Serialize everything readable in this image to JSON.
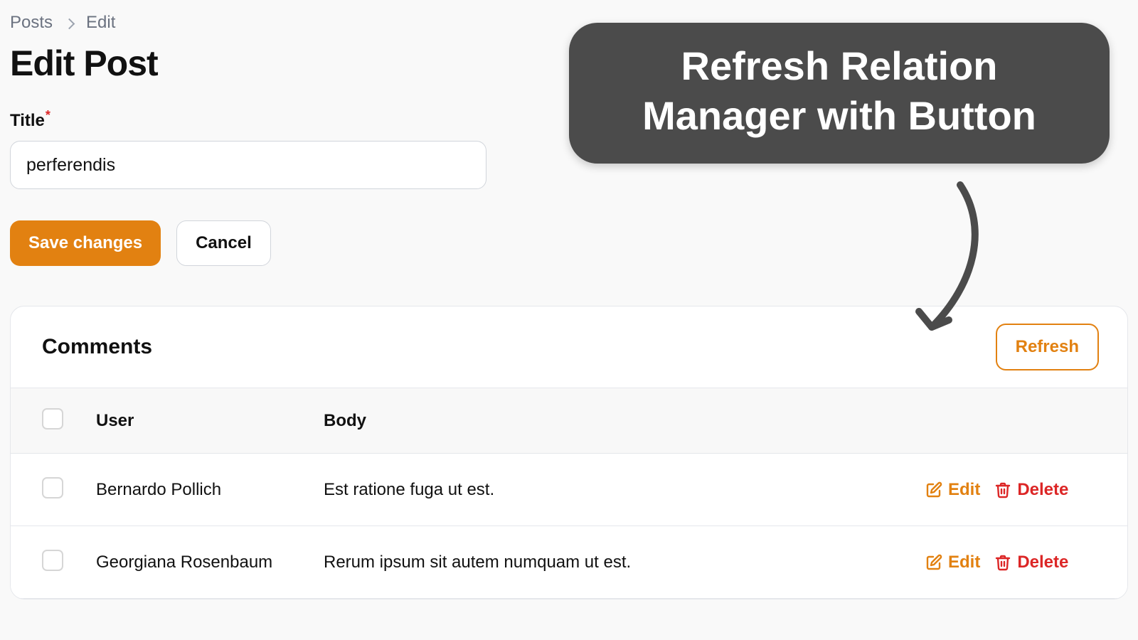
{
  "breadcrumb": {
    "root": "Posts",
    "current": "Edit"
  },
  "page_title": "Edit Post",
  "form": {
    "title_label": "Title",
    "title_value": "perferendis",
    "save_label": "Save changes",
    "cancel_label": "Cancel"
  },
  "comments_panel": {
    "title": "Comments",
    "refresh_label": "Refresh",
    "columns": {
      "user": "User",
      "body": "Body"
    },
    "rows": [
      {
        "user": "Bernardo Pollich",
        "body": "Est ratione fuga ut est."
      },
      {
        "user": "Georgiana Rosenbaum",
        "body": "Rerum ipsum sit autem numquam ut est."
      }
    ],
    "row_actions": {
      "edit": "Edit",
      "delete": "Delete"
    }
  },
  "annotation": {
    "line1": "Refresh Relation",
    "line2": "Manager with Button"
  },
  "colors": {
    "accent": "#e28111",
    "danger": "#dc2626",
    "annot_bg": "#4b4b4b"
  }
}
